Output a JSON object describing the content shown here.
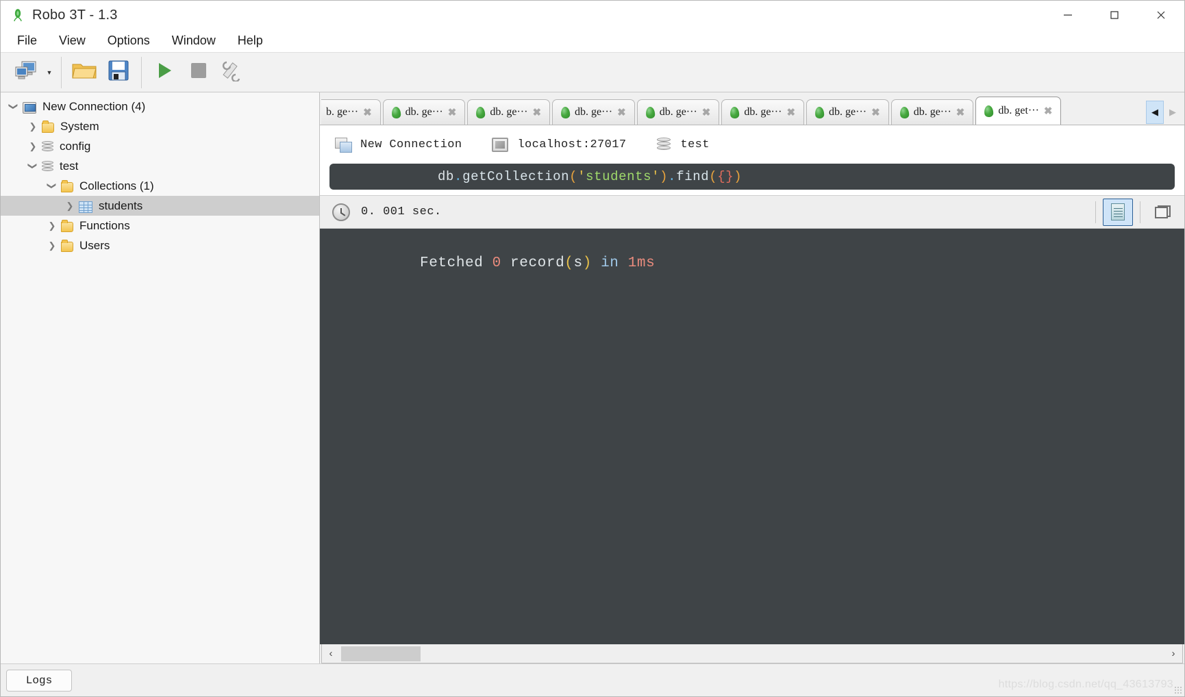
{
  "window": {
    "title": "Robo 3T - 1.3",
    "logo_icon": "robo3t-leaf-logo",
    "minimize_icon": "minimize-icon",
    "maximize_icon": "maximize-icon",
    "close_icon": "close-icon"
  },
  "menu": {
    "items": [
      {
        "label": "File"
      },
      {
        "label": "View"
      },
      {
        "label": "Options"
      },
      {
        "label": "Window"
      },
      {
        "label": "Help"
      }
    ]
  },
  "toolbar": {
    "buttons": [
      {
        "name": "connect-button",
        "icon": "connect-computers-icon"
      },
      {
        "name": "connect-dropdown",
        "icon": "chevron-down-icon"
      },
      {
        "name": "open-script-button",
        "icon": "open-folder-icon"
      },
      {
        "name": "save-script-button",
        "icon": "floppy-save-icon"
      },
      {
        "name": "execute-button",
        "icon": "play-triangle-icon"
      },
      {
        "name": "stop-button",
        "icon": "stop-square-icon"
      },
      {
        "name": "toggle-orientation-button",
        "icon": "wrench-tools-icon"
      }
    ]
  },
  "sidebar": {
    "tree": [
      {
        "label": "New Connection (4)",
        "icon": "server-icon",
        "twisty": "expanded",
        "indent": 0,
        "selected": false
      },
      {
        "label": "System",
        "icon": "folder-icon",
        "twisty": "collapsed",
        "indent": 1,
        "selected": false
      },
      {
        "label": "config",
        "icon": "database-icon",
        "twisty": "collapsed",
        "indent": 1,
        "selected": false
      },
      {
        "label": "test",
        "icon": "database-icon",
        "twisty": "expanded",
        "indent": 1,
        "selected": false
      },
      {
        "label": "Collections (1)",
        "icon": "folder-icon",
        "twisty": "expanded",
        "indent": 2,
        "selected": false
      },
      {
        "label": "students",
        "icon": "collection-table-icon",
        "twisty": "collapsed",
        "indent": 3,
        "selected": true
      },
      {
        "label": "Functions",
        "icon": "folder-icon",
        "twisty": "collapsed",
        "indent": 2,
        "selected": false
      },
      {
        "label": "Users",
        "icon": "folder-icon",
        "twisty": "collapsed",
        "indent": 2,
        "selected": false
      }
    ]
  },
  "tabs": {
    "items": [
      {
        "label": "b. ge···",
        "active": false,
        "clipped": true,
        "icon": "leaf-icon",
        "close_icon": "close-icon"
      },
      {
        "label": "db. ge···",
        "active": false,
        "clipped": false,
        "icon": "leaf-icon",
        "close_icon": "close-icon"
      },
      {
        "label": "db. ge···",
        "active": false,
        "clipped": false,
        "icon": "leaf-icon",
        "close_icon": "close-icon"
      },
      {
        "label": "db. ge···",
        "active": false,
        "clipped": false,
        "icon": "leaf-icon",
        "close_icon": "close-icon"
      },
      {
        "label": "db. ge···",
        "active": false,
        "clipped": false,
        "icon": "leaf-icon",
        "close_icon": "close-icon"
      },
      {
        "label": "db. ge···",
        "active": false,
        "clipped": false,
        "icon": "leaf-icon",
        "close_icon": "close-icon"
      },
      {
        "label": "db. ge···",
        "active": false,
        "clipped": false,
        "icon": "leaf-icon",
        "close_icon": "close-icon"
      },
      {
        "label": "db. ge···",
        "active": false,
        "clipped": false,
        "icon": "leaf-icon",
        "close_icon": "close-icon"
      },
      {
        "label": "db. get···",
        "active": true,
        "clipped": false,
        "icon": "leaf-icon",
        "close_icon": "close-icon"
      }
    ],
    "scroll_left_icon": "◀",
    "scroll_right_icon": "▶"
  },
  "connection_bar": {
    "connection_name": "New Connection",
    "host": "localhost:27017",
    "database": "test",
    "connection_icon": "connection-icon",
    "host_icon": "monitor-icon",
    "database_icon": "database-icon"
  },
  "editor": {
    "query": "db.getCollection('students').find({})",
    "parts": [
      {
        "t": "db",
        "c": "plain"
      },
      {
        "t": ".",
        "c": "dot"
      },
      {
        "t": "getCollection",
        "c": "fn"
      },
      {
        "t": "(",
        "c": "paren"
      },
      {
        "t": "'",
        "c": "quote"
      },
      {
        "t": "students",
        "c": "str"
      },
      {
        "t": "'",
        "c": "quote"
      },
      {
        "t": ")",
        "c": "paren"
      },
      {
        "t": ".",
        "c": "dot"
      },
      {
        "t": "find",
        "c": "fn"
      },
      {
        "t": "(",
        "c": "paren"
      },
      {
        "t": "{}",
        "c": "brace"
      },
      {
        "t": ")",
        "c": "paren"
      }
    ]
  },
  "result_toolbar": {
    "elapsed": "0. 001 sec.",
    "clock_icon": "clock-icon",
    "text_view_icon": "document-view-icon",
    "custom_view_icon": "window-view-icon"
  },
  "results": {
    "message": "Fetched 0 record(s) in 1ms",
    "parts": [
      {
        "t": "Fetched ",
        "c": "white"
      },
      {
        "t": "0",
        "c": "num"
      },
      {
        "t": " record",
        "c": "white"
      },
      {
        "t": "(",
        "c": "paren"
      },
      {
        "t": "s",
        "c": "white"
      },
      {
        "t": ")",
        "c": "paren"
      },
      {
        "t": " ",
        "c": "white"
      },
      {
        "t": "in",
        "c": "blue"
      },
      {
        "t": " ",
        "c": "white"
      },
      {
        "t": "1ms",
        "c": "num"
      }
    ]
  },
  "scrollbar": {
    "left_arrow": "‹",
    "right_arrow": "›"
  },
  "statusbar": {
    "logs_label": "Logs",
    "watermark": "https://blog.csdn.net/qq_43613793"
  },
  "colors": {
    "editor_bg": "#3f4447",
    "accent_selected": "#cfe4f8",
    "tree_selection": "#cecece",
    "leaf_green": "#47a83f"
  }
}
